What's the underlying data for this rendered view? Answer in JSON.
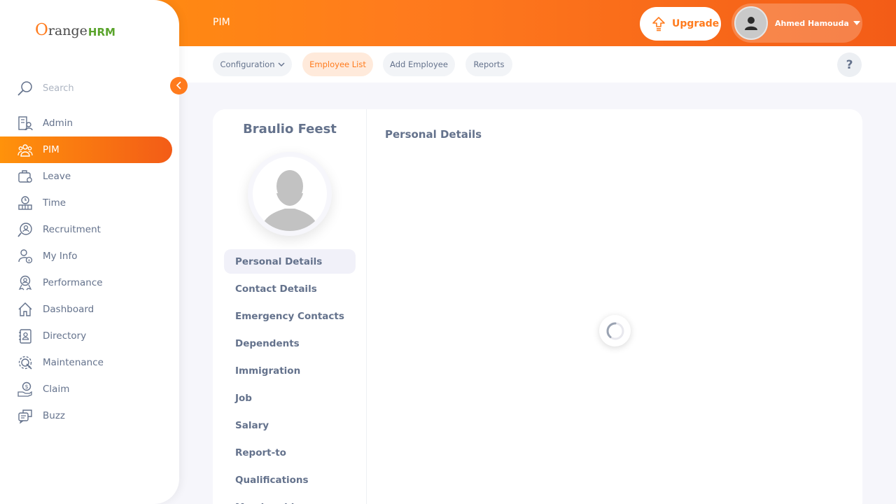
{
  "brand": {
    "logo_o": "O",
    "logo_rest": "range",
    "logo_hrm": "HRM"
  },
  "topbar": {
    "module_title": "PIM",
    "upgrade_label": "Upgrade",
    "user_name": "Ahmed Hamouda"
  },
  "subnav": {
    "tabs": [
      {
        "label": "Configuration"
      },
      {
        "label": "Employee List"
      },
      {
        "label": "Add Employee"
      },
      {
        "label": "Reports"
      }
    ],
    "help_label": "?"
  },
  "sidebar": {
    "search_placeholder": "Search",
    "items": [
      {
        "label": "Admin",
        "icon": "admin-icon"
      },
      {
        "label": "PIM",
        "icon": "pim-icon"
      },
      {
        "label": "Leave",
        "icon": "leave-icon"
      },
      {
        "label": "Time",
        "icon": "time-icon"
      },
      {
        "label": "Recruitment",
        "icon": "recruitment-icon"
      },
      {
        "label": "My Info",
        "icon": "my-info-icon"
      },
      {
        "label": "Performance",
        "icon": "performance-icon"
      },
      {
        "label": "Dashboard",
        "icon": "dashboard-icon"
      },
      {
        "label": "Directory",
        "icon": "directory-icon"
      },
      {
        "label": "Maintenance",
        "icon": "maintenance-icon"
      },
      {
        "label": "Claim",
        "icon": "claim-icon"
      },
      {
        "label": "Buzz",
        "icon": "buzz-icon"
      }
    ]
  },
  "employee": {
    "name": "Braulio Feest",
    "tabs": [
      {
        "label": "Personal Details"
      },
      {
        "label": "Contact Details"
      },
      {
        "label": "Emergency Contacts"
      },
      {
        "label": "Dependents"
      },
      {
        "label": "Immigration"
      },
      {
        "label": "Job"
      },
      {
        "label": "Salary"
      },
      {
        "label": "Report-to"
      },
      {
        "label": "Qualifications"
      },
      {
        "label": "Memberships"
      }
    ]
  },
  "content": {
    "title": "Personal Details"
  },
  "colors": {
    "accent": "#ff7b1d",
    "text": "#64728c",
    "background": "#f6f6fb"
  }
}
